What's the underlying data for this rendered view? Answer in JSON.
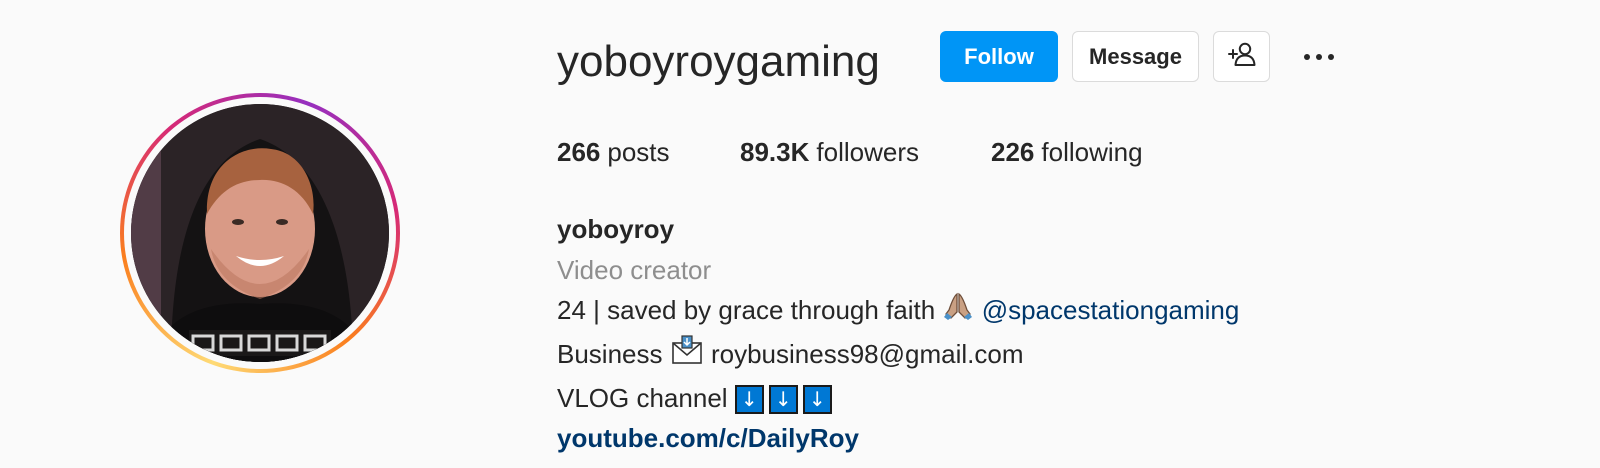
{
  "profile": {
    "username": "yoboyroygaming",
    "buttons": {
      "follow": "Follow",
      "message": "Message"
    },
    "stats": {
      "posts_count": "266",
      "posts_label": "posts",
      "followers_count": "89.3K",
      "followers_label": "followers",
      "following_count": "226",
      "following_label": "following"
    },
    "bio": {
      "name": "yoboyroy",
      "category": "Video creator",
      "line1_text": "24 | saved by grace through faith",
      "line1_mention": "@spacestationgaming",
      "line2_prefix": "Business",
      "line2_email": "roybusiness98@gmail.com",
      "line3_text": "VLOG channel",
      "arrow": "↓",
      "link": "youtube.com/c/DailyRoy"
    }
  },
  "icons": {
    "suggest": "add-person-icon",
    "more": "more-options-icon",
    "pray": "praying-hands-emoji",
    "envelope": "envelope-emoji",
    "arrows": "down-arrow-emoji"
  },
  "colors": {
    "follow_button": "#0095f6",
    "link": "#00376b",
    "category": "#8e8e8e"
  }
}
